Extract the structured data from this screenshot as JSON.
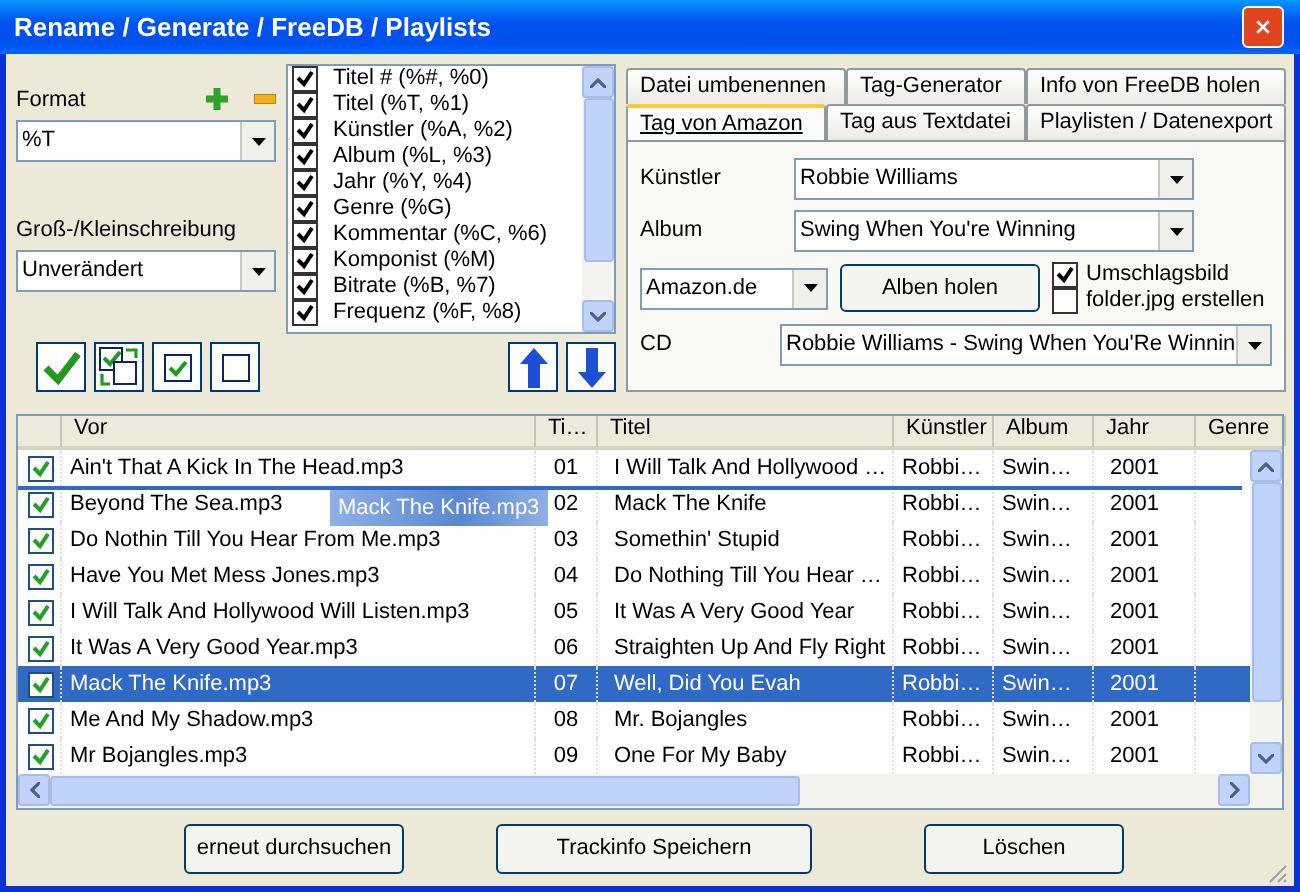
{
  "window": {
    "title": "Rename / Generate / FreeDB / Playlists"
  },
  "format": {
    "label": "Format",
    "value": "%T"
  },
  "case": {
    "label": "Groß-/Kleinschreibung",
    "value": "Unverändert"
  },
  "fields": [
    {
      "label": "Titel # (%#, %0)",
      "checked": true
    },
    {
      "label": "Titel (%T, %1)",
      "checked": true
    },
    {
      "label": "Künstler (%A, %2)",
      "checked": true
    },
    {
      "label": "Album (%L, %3)",
      "checked": true
    },
    {
      "label": "Jahr (%Y, %4)",
      "checked": true
    },
    {
      "label": "Genre (%G)",
      "checked": true
    },
    {
      "label": "Kommentar (%C, %6)",
      "checked": true
    },
    {
      "label": "Komponist (%M)",
      "checked": true
    },
    {
      "label": "Bitrate (%B, %7)",
      "checked": true
    },
    {
      "label": "Frequenz (%F, %8)",
      "checked": true
    }
  ],
  "tab_rows": [
    [
      {
        "label": "Datei umbenennen",
        "selected": false
      },
      {
        "label": "Tag-Generator",
        "selected": false
      },
      {
        "label": "Info von FreeDB holen",
        "selected": false
      }
    ],
    [
      {
        "label": "Tag von Amazon",
        "selected": true
      },
      {
        "label": "Tag aus Textdatei",
        "selected": false
      },
      {
        "label": "Playlisten / Datenexport",
        "selected": false
      }
    ]
  ],
  "amazon": {
    "artist_label": "Künstler",
    "artist": "Robbie Williams",
    "album_label": "Album",
    "album": "Swing When You're Winning",
    "store": "Amazon.de",
    "fetch_button": "Alben holen",
    "options": [
      {
        "label": "Umschlagsbild",
        "checked": true
      },
      {
        "label": "folder.jpg erstellen",
        "checked": false
      }
    ],
    "cd_label": "CD",
    "cd": "Robbie Williams - Swing When You'Re Winnin"
  },
  "table": {
    "columns": [
      "Vor",
      "Ti…",
      "Titel",
      "Künstler",
      "Album",
      "Jahr",
      "Genre"
    ],
    "rows": [
      {
        "checked": true,
        "selected": false,
        "cells": [
          "Ain't That A Kick In The Head.mp3",
          "01",
          "I Will Talk And Hollywood …",
          "Robbi…",
          "Swin…",
          "2001"
        ]
      },
      {
        "checked": true,
        "selected": false,
        "cells": [
          "Beyond The Sea.mp3",
          "02",
          "Mack The Knife",
          "Robbi…",
          "Swin…",
          "2001"
        ]
      },
      {
        "checked": true,
        "selected": false,
        "cells": [
          "Do Nothin Till You Hear From Me.mp3",
          "03",
          "Somethin' Stupid",
          "Robbi…",
          "Swin…",
          "2001"
        ]
      },
      {
        "checked": true,
        "selected": false,
        "cells": [
          "Have You Met Mess Jones.mp3",
          "04",
          "Do Nothing Till You Hear …",
          "Robbi…",
          "Swin…",
          "2001"
        ]
      },
      {
        "checked": true,
        "selected": false,
        "cells": [
          "I Will Talk And Hollywood Will Listen.mp3",
          "05",
          "It Was A Very Good Year",
          "Robbi…",
          "Swin…",
          "2001"
        ]
      },
      {
        "checked": true,
        "selected": false,
        "cells": [
          "It Was A Very Good Year.mp3",
          "06",
          "Straighten Up And Fly Right",
          "Robbi…",
          "Swin…",
          "2001"
        ]
      },
      {
        "checked": true,
        "selected": true,
        "cells": [
          "Mack The Knife.mp3",
          "07",
          "Well, Did You Evah",
          "Robbi…",
          "Swin…",
          "2001"
        ]
      },
      {
        "checked": true,
        "selected": false,
        "cells": [
          "Me And My Shadow.mp3",
          "08",
          "Mr. Bojangles",
          "Robbi…",
          "Swin…",
          "2001"
        ]
      },
      {
        "checked": true,
        "selected": false,
        "cells": [
          "Mr Bojangles.mp3",
          "09",
          "One For My Baby",
          "Robbi…",
          "Swin…",
          "2001"
        ]
      }
    ],
    "drag_ghost": {
      "text": "Mack The Knife.mp3"
    }
  },
  "buttons": [
    "erneut durchsuchen",
    "Trackinfo Speichern",
    "Löschen"
  ]
}
